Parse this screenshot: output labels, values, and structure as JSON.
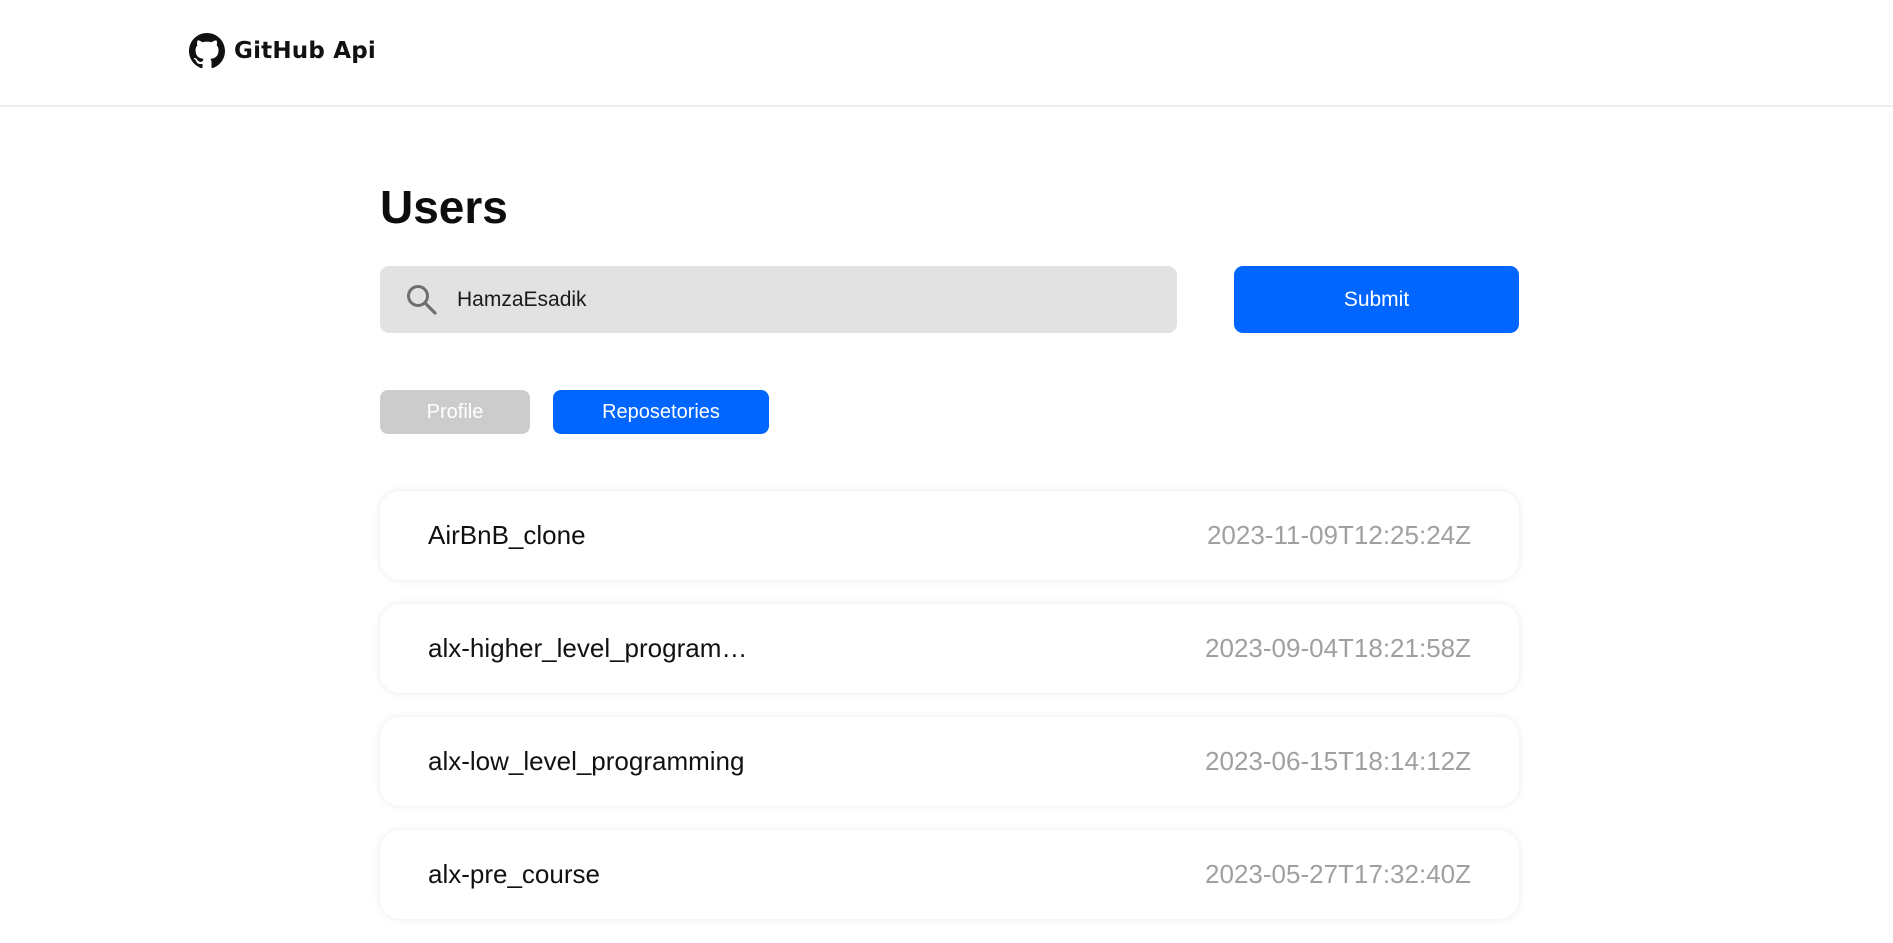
{
  "navbar": {
    "brand_icon": "github-icon",
    "brand_text": "GitHub Api"
  },
  "page": {
    "title": "Users"
  },
  "search": {
    "icon": "search-icon",
    "value": "HamzaEsadik"
  },
  "submit": {
    "label": "Submit"
  },
  "tabs": [
    {
      "label": "Profile",
      "active": false
    },
    {
      "label": "Reposetories",
      "active": true
    }
  ],
  "repos": [
    {
      "name": "AirBnB_clone",
      "date": "2023-11-09T12:25:24Z"
    },
    {
      "name": "alx-higher_level_programming",
      "date": "2023-09-04T18:21:58Z"
    },
    {
      "name": "alx-low_level_programming",
      "date": "2023-06-15T18:14:12Z"
    },
    {
      "name": "alx-pre_course",
      "date": "2023-05-27T17:32:40Z"
    }
  ],
  "colors": {
    "accent": "#0066ff",
    "inactive_tab": "#cccccc",
    "search_bg": "#e2e2e2",
    "date_text": "#a0a0a0"
  }
}
